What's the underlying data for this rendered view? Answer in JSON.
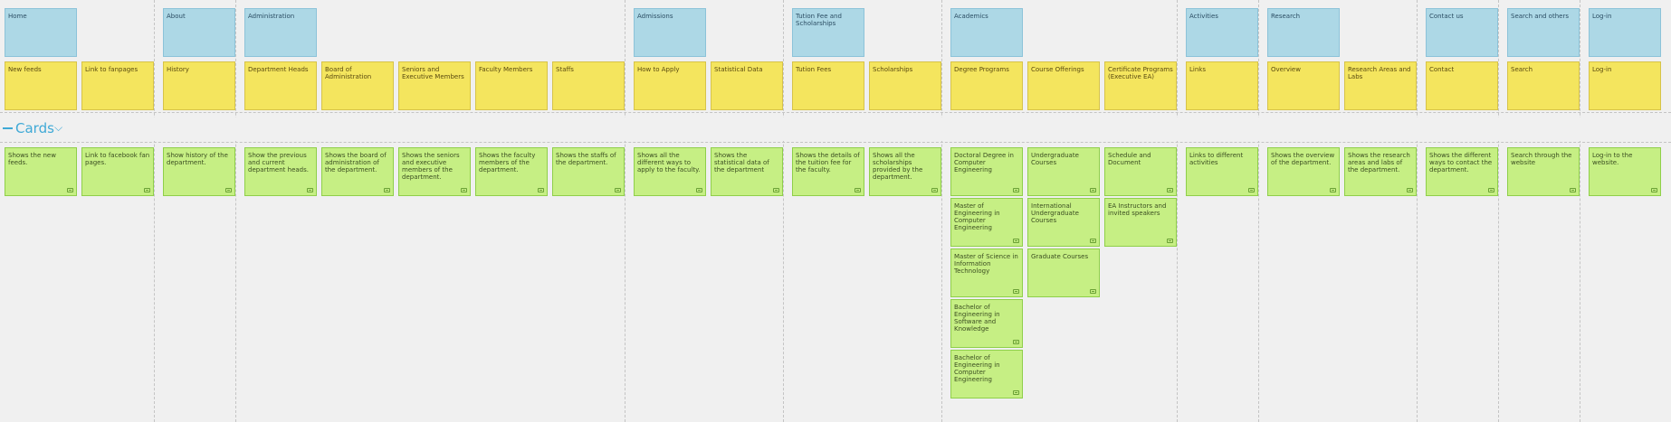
{
  "release": {
    "label": "Cards",
    "chevron": "chevron-down-icon"
  },
  "epics": [
    {
      "title": "Home",
      "features": [
        {
          "title": "New feeds",
          "stories": [
            "Shows the new feeds."
          ]
        },
        {
          "title": "Link to fanpages",
          "stories": [
            "Link to facebook fan pages."
          ]
        }
      ]
    },
    {
      "title": "About",
      "features": [
        {
          "title": "History",
          "stories": [
            "Show history of the department."
          ]
        }
      ]
    },
    {
      "title": "Administration",
      "features": [
        {
          "title": "Department Heads",
          "stories": [
            "Show the previous and current department heads."
          ]
        },
        {
          "title": "Board of Administration",
          "stories": [
            "Shows the board of administration of the department."
          ]
        },
        {
          "title": "Seniors and Executive Members",
          "stories": [
            "Shows the seniors and executive members of the department."
          ]
        },
        {
          "title": "Faculty Members",
          "stories": [
            "Shows the faculty members of the department."
          ]
        },
        {
          "title": "Staffs",
          "stories": [
            "Shows the staffs of the department."
          ]
        }
      ]
    },
    {
      "title": "Admissions",
      "features": [
        {
          "title": "How to Apply",
          "stories": [
            "Shows all the different ways to apply to the faculty."
          ]
        },
        {
          "title": "Statistical Data",
          "stories": [
            "Shows the statistical data of the department"
          ]
        }
      ]
    },
    {
      "title": "Tution Fee and Scholarships",
      "features": [
        {
          "title": "Tution Fees",
          "stories": [
            "Shows the details of the tuition fee for the faculty."
          ]
        },
        {
          "title": "Scholarships",
          "stories": [
            "Shows all the scholarships provided by the department."
          ]
        }
      ]
    },
    {
      "title": "Academics",
      "features": [
        {
          "title": "Degree Programs",
          "stories": [
            "Doctoral Degree in Computer Engineering",
            "Master of Engineering in Computer Engineering",
            "Master of Science in Information Technology",
            "Bachelor of Engineering in Software and Knowledge",
            "Bachelor of Engineering in Computer Engineering"
          ]
        },
        {
          "title": "Course Offerings",
          "stories": [
            "Undergraduate Courses",
            "International Undergraduate Courses",
            "Graduate Courses"
          ]
        },
        {
          "title": "Certificate Programs (Executive EA)",
          "stories": [
            "Schedule and Document",
            "EA Instructors and invited speakers"
          ]
        }
      ]
    },
    {
      "title": "Activities",
      "features": [
        {
          "title": "Links",
          "stories": [
            "Links to different activities"
          ]
        }
      ]
    },
    {
      "title": "Research",
      "features": [
        {
          "title": "Overview",
          "stories": [
            "Shows the overview of the department."
          ]
        },
        {
          "title": "Research Areas and Labs",
          "stories": [
            "Shows the research areas and labs of the department."
          ]
        }
      ]
    },
    {
      "title": "Contact us",
      "features": [
        {
          "title": "Contact",
          "stories": [
            "Shows the different ways to contact the department."
          ]
        }
      ]
    },
    {
      "title": "Search and others",
      "features": [
        {
          "title": "Search",
          "stories": [
            "Search through the website"
          ]
        }
      ]
    },
    {
      "title": "Log-in",
      "features": [
        {
          "title": "Log-in",
          "stories": [
            "Log-in to the website."
          ]
        }
      ]
    }
  ]
}
